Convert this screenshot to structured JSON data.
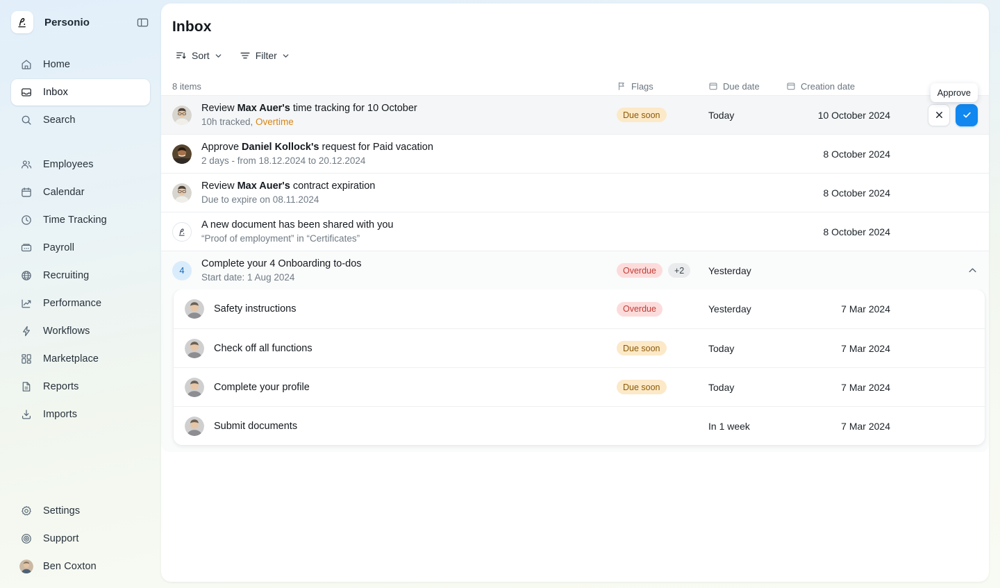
{
  "brand": {
    "name": "Personio",
    "logo_icon": "personio-logo",
    "toggle_icon": "sidebar-toggle-icon"
  },
  "sidebar": {
    "primary": [
      {
        "label": "Home",
        "icon": "home-icon",
        "active": false
      },
      {
        "label": "Inbox",
        "icon": "inbox-icon",
        "active": true
      },
      {
        "label": "Search",
        "icon": "search-icon",
        "active": false
      }
    ],
    "secondary": [
      {
        "label": "Employees",
        "icon": "people-icon"
      },
      {
        "label": "Calendar",
        "icon": "calendar-icon"
      },
      {
        "label": "Time Tracking",
        "icon": "clock-icon"
      },
      {
        "label": "Payroll",
        "icon": "payroll-icon"
      },
      {
        "label": "Recruiting",
        "icon": "globe-icon"
      },
      {
        "label": "Performance",
        "icon": "chart-arrow-icon"
      },
      {
        "label": "Workflows",
        "icon": "bolt-icon"
      },
      {
        "label": "Marketplace",
        "icon": "grid-icon"
      },
      {
        "label": "Reports",
        "icon": "document-icon"
      },
      {
        "label": "Imports",
        "icon": "import-icon"
      }
    ],
    "bottom": [
      {
        "label": "Settings",
        "icon": "gear-icon"
      },
      {
        "label": "Support",
        "icon": "lifebuoy-icon"
      }
    ],
    "user": {
      "label": "Ben Coxton",
      "icon": "avatar"
    }
  },
  "header": {
    "title": "Inbox"
  },
  "toolbar": {
    "sort_label": "Sort",
    "sort_icon": "sort-icon",
    "filter_label": "Filter",
    "filter_icon": "filter-icon",
    "chevron_icon": "chevron-down-icon"
  },
  "table": {
    "count_label": "8 items",
    "columns": {
      "flags": "Flags",
      "due": "Due date",
      "created": "Creation date",
      "flags_icon": "flag-icon",
      "due_icon": "calendar-icon",
      "created_icon": "calendar-icon"
    },
    "rows": [
      {
        "title_prefix": "Review ",
        "title_bold": "Max Auer's",
        "title_suffix": " time tracking for 10 October",
        "subtitle_prefix": "10h tracked, ",
        "subtitle_highlight": "Overtime",
        "flag": "Due soon",
        "flag_type": "due-soon",
        "due": "Today",
        "created": "10 October 2024",
        "avatar": "avatar-max-auer",
        "highlighted": true,
        "actions": {
          "reject_icon": "close-icon",
          "approve_icon": "check-icon",
          "tooltip": "Approve"
        }
      },
      {
        "title_prefix": "Approve ",
        "title_bold": "Daniel Kollock's",
        "title_suffix": " request for Paid vacation",
        "subtitle_prefix": "2 days - from 18.12.2024 to 20.12.2024",
        "subtitle_highlight": "",
        "flag": "",
        "flag_type": "",
        "due": "",
        "created": "8 October 2024",
        "avatar": "avatar-daniel-kollock",
        "highlighted": false
      },
      {
        "title_prefix": "Review ",
        "title_bold": "Max Auer's",
        "title_suffix": " contract expiration",
        "subtitle_prefix": "Due to expire on 08.11.2024",
        "subtitle_highlight": "",
        "flag": "",
        "flag_type": "",
        "due": "",
        "created": "8 October 2024",
        "avatar": "avatar-max-auer",
        "highlighted": false
      },
      {
        "title_prefix": "A new document has been shared with you",
        "title_bold": "",
        "title_suffix": "",
        "subtitle_prefix": "“Proof of employment” in “Certificates”",
        "subtitle_highlight": "",
        "flag": "",
        "flag_type": "",
        "due": "",
        "created": "8 October 2024",
        "avatar": "personio-doc-icon",
        "highlighted": false
      }
    ],
    "group_row": {
      "count_badge": "4",
      "title": "Complete your 4 Onboarding to-dos",
      "subtitle": "Start date: 1 Aug 2024",
      "flag": "Overdue",
      "flag_type": "overdue",
      "flag_more": "+2",
      "due": "Yesterday",
      "created": "",
      "collapse_icon": "chevron-up-icon",
      "expanded": true,
      "children": [
        {
          "title": "Safety instructions",
          "flag": "Overdue",
          "flag_type": "overdue",
          "due": "Yesterday",
          "created": "7 Mar 2024",
          "avatar": "avatar-employee"
        },
        {
          "title": "Check off all functions",
          "flag": "Due soon",
          "flag_type": "due-soon",
          "due": "Today",
          "created": "7 Mar 2024",
          "avatar": "avatar-employee"
        },
        {
          "title": "Complete your profile",
          "flag": "Due soon",
          "flag_type": "due-soon",
          "due": "Today",
          "created": "7 Mar 2024",
          "avatar": "avatar-employee"
        },
        {
          "title": "Submit documents",
          "flag": "",
          "flag_type": "",
          "due": "In 1 week",
          "created": "7 Mar 2024",
          "avatar": "avatar-employee"
        }
      ]
    }
  },
  "colors": {
    "accent_blue": "#1088f0",
    "due_soon_bg": "#fce9c8",
    "due_soon_fg": "#8a5a08",
    "overdue_bg": "#fcdcdb",
    "overdue_fg": "#c03c36",
    "overtime_fg": "#d88512",
    "badge_blue_bg": "#d9ecfb",
    "badge_blue_fg": "#1b6cb5"
  }
}
